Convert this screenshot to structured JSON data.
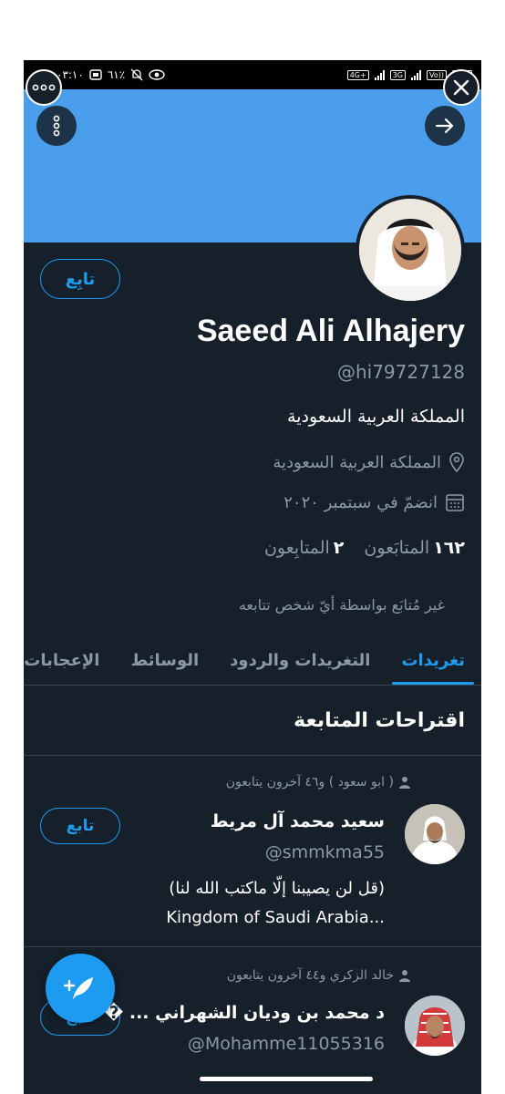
{
  "status_bar": {
    "time": "٠٣:١٠",
    "battery": "٦١٪",
    "network_labels": [
      "4G+",
      "3G",
      "Vo))"
    ]
  },
  "profile": {
    "follow_label": "تابِع",
    "name": "Saeed Ali Alhajery",
    "handle": "@hi79727128",
    "bio": "المملكة العربية السعودية",
    "location": "المملكة العربية السعودية",
    "joined": "انضمّ في سبتمبر ٢٠٢٠",
    "following_count": "١٦٢",
    "following_label": "المتابَعون",
    "followers_count": "٢",
    "followers_label": "المتابِعون",
    "not_followed_note": "غير مُتابَع بواسطة أيّ شخص تتابعه"
  },
  "tabs": [
    {
      "label": "تغريدات",
      "active": true
    },
    {
      "label": "التغريدات والردود",
      "active": false
    },
    {
      "label": "الوسائط",
      "active": false
    },
    {
      "label": "الإعجابات",
      "active": false
    }
  ],
  "suggestions": {
    "title": "اقتراحات المتابعة",
    "items": [
      {
        "context": "( ابو سعود ) و٤٦ آخرون يتابعون",
        "name": "سعيد محمد آل مريط",
        "handle": "@smmkma55",
        "bio_line1": "(قل لن يصيبنا إلّا ماكتب الله لنا)",
        "bio_line2": "Kingdom of Saudi Arabia...",
        "follow_label": "تابع"
      },
      {
        "context": "خالد الزكري و٤٤ آخرون يتابعون",
        "name": "د محمد بن وديان الشهراني ... �",
        "handle": "@Mohamme11055316",
        "follow_label": "تابع"
      }
    ]
  },
  "colors": {
    "background": "#15202b",
    "banner": "#4a9eeb",
    "accent": "#1d9bf0",
    "secondary_text": "#8b98a5"
  },
  "icons": {
    "menu": "more-horizontal-icon",
    "close": "close-icon",
    "banner_menu": "more-vertical-icon",
    "forward": "arrow-right-icon",
    "location": "map-pin-icon",
    "calendar": "calendar-icon",
    "person": "person-icon",
    "compose": "compose-tweet-icon"
  }
}
